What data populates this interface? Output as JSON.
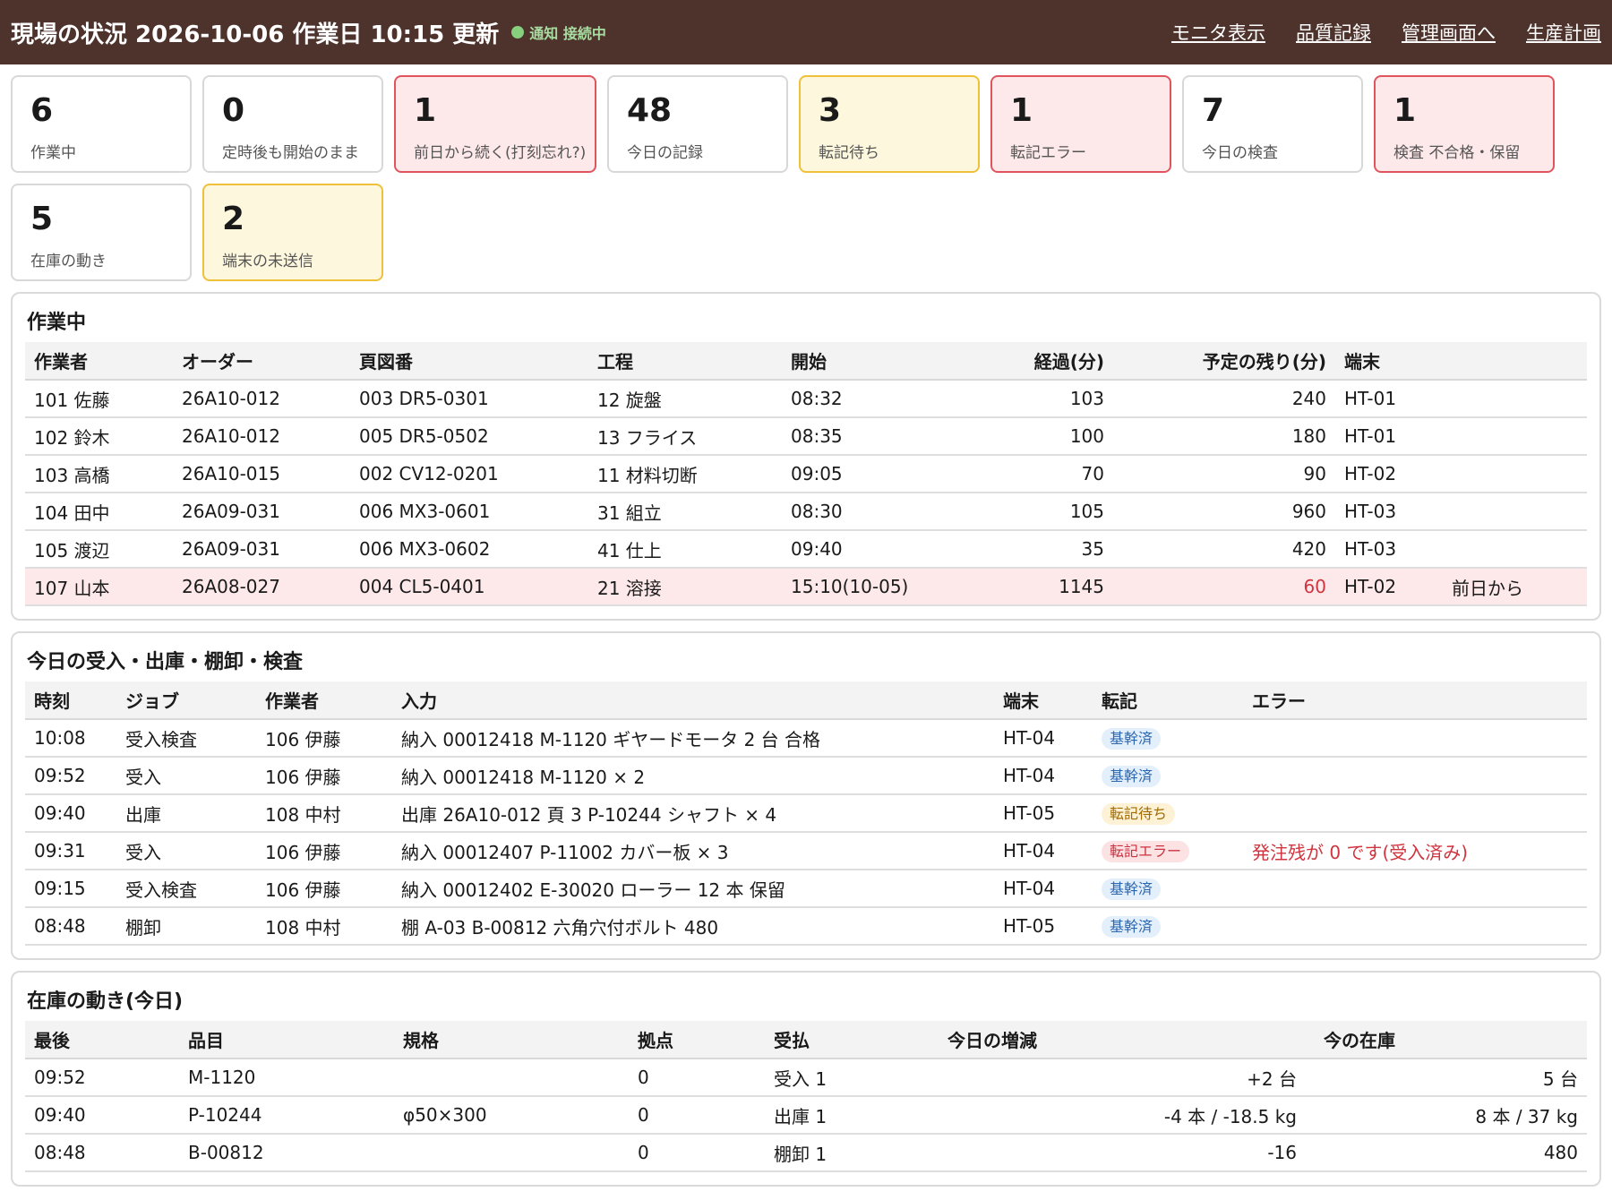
{
  "header": {
    "title": "現場の状況 2026-10-06 作業日 10:15 更新",
    "connection": "通知 接続中",
    "nav": [
      "モニタ表示",
      "品質記録",
      "管理画面へ",
      "生産計画"
    ]
  },
  "cards": [
    {
      "value": "6",
      "label": "作業中"
    },
    {
      "value": "0",
      "label": "定時後も開始のまま"
    },
    {
      "value": "1",
      "label": "前日から続く(打刻忘れ?)"
    },
    {
      "value": "48",
      "label": "今日の記録"
    },
    {
      "value": "3",
      "label": "転記待ち"
    },
    {
      "value": "1",
      "label": "転記エラー"
    },
    {
      "value": "7",
      "label": "今日の検査"
    },
    {
      "value": "1",
      "label": "検査 不合格・保留"
    },
    {
      "value": "5",
      "label": "在庫の動き"
    },
    {
      "value": "2",
      "label": "端末の未送信"
    }
  ],
  "working": {
    "title": "作業中",
    "headers": [
      "作業者",
      "オーダー",
      "頁図番",
      "工程",
      "開始",
      "経過(分)",
      "予定の残り(分)",
      "端末",
      ""
    ],
    "rows": [
      [
        "101 佐藤",
        "26A10-012",
        "003 DR5-0301",
        "12 旋盤",
        "08:32",
        "103",
        "240",
        "HT-01",
        ""
      ],
      [
        "102 鈴木",
        "26A10-012",
        "005 DR5-0502",
        "13 フライス",
        "08:35",
        "100",
        "180",
        "HT-01",
        ""
      ],
      [
        "103 高橋",
        "26A10-015",
        "002 CV12-0201",
        "11 材料切断",
        "09:05",
        "70",
        "90",
        "HT-02",
        ""
      ],
      [
        "104 田中",
        "26A09-031",
        "006 MX3-0601",
        "31 組立",
        "08:30",
        "105",
        "960",
        "HT-03",
        ""
      ],
      [
        "105 渡辺",
        "26A09-031",
        "006 MX3-0602",
        "41 仕上",
        "09:40",
        "35",
        "420",
        "HT-03",
        ""
      ],
      [
        "107 山本",
        "26A08-027",
        "004 CL5-0401",
        "21 溶接",
        "15:10(10-05)",
        "1145",
        "60",
        "HT-02",
        "前日から"
      ]
    ]
  },
  "today": {
    "title": "今日の受入・出庫・棚卸・検査",
    "headers": [
      "時刻",
      "ジョブ",
      "作業者",
      "入力",
      "端末",
      "転記",
      "エラー"
    ],
    "rows": [
      [
        "10:08",
        "受入検査",
        "106 伊藤",
        "納入 00012418 M-1120 ギヤードモータ 2 台 合格",
        "HT-04",
        "基幹済",
        ""
      ],
      [
        "09:52",
        "受入",
        "106 伊藤",
        "納入 00012418 M-1120 × 2",
        "HT-04",
        "基幹済",
        ""
      ],
      [
        "09:40",
        "出庫",
        "108 中村",
        "出庫 26A10-012 頁 3 P-10244 シャフト × 4",
        "HT-05",
        "転記待ち",
        ""
      ],
      [
        "09:31",
        "受入",
        "106 伊藤",
        "納入 00012407 P-11002 カバー板 × 3",
        "HT-04",
        "転記エラー",
        "発注残が 0 です(受入済み)"
      ],
      [
        "09:15",
        "受入検査",
        "106 伊藤",
        "納入 00012402 E-30020 ローラー 12 本 保留",
        "HT-04",
        "基幹済",
        ""
      ],
      [
        "08:48",
        "棚卸",
        "108 中村",
        "棚 A-03 B-00812 六角穴付ボルト 480",
        "HT-05",
        "基幹済",
        ""
      ]
    ]
  },
  "stock": {
    "title": "在庫の動き(今日)",
    "headers": [
      "最後",
      "品目",
      "規格",
      "拠点",
      "受払",
      "今日の増減",
      "今の在庫"
    ],
    "rows": [
      [
        "09:52",
        "M-1120",
        "",
        "0",
        "受入 1",
        "+2 台",
        "5 台"
      ],
      [
        "09:40",
        "P-10244",
        "φ50×300",
        "0",
        "出庫 1",
        "-4 本 / -18.5 kg",
        "8 本 / 37 kg"
      ],
      [
        "08:48",
        "B-00812",
        "",
        "0",
        "棚卸 1",
        "-16",
        "480"
      ]
    ]
  }
}
